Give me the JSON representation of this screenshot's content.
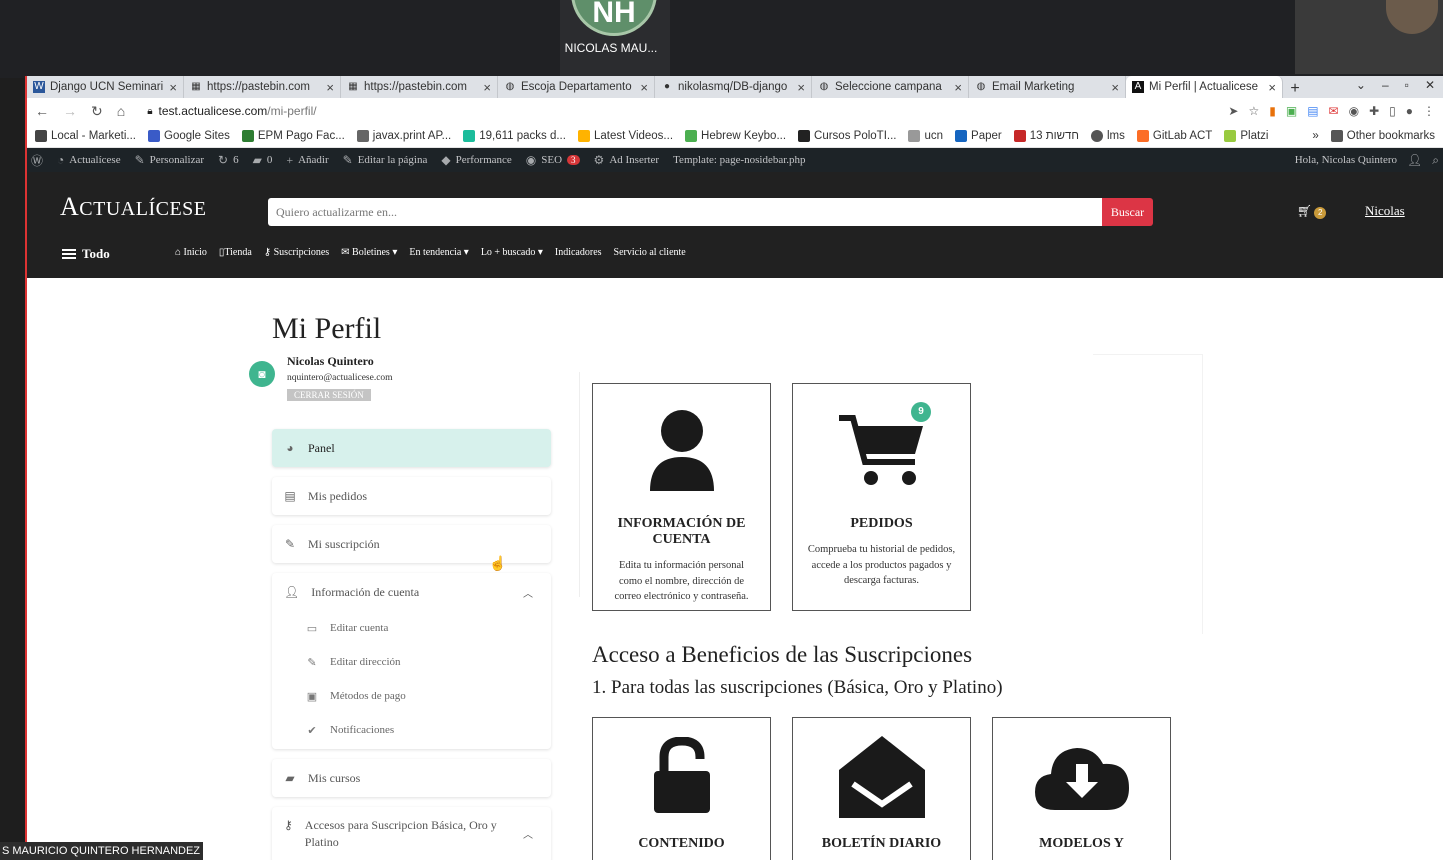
{
  "call": {
    "participant_initials": "NH",
    "participant_name": "NICOLAS MAU...",
    "presenter_label": "S MAURICIO QUINTERO HERNANDEZ"
  },
  "browser": {
    "tabs": [
      {
        "label": "Django UCN Seminari",
        "icon": "word-icon",
        "active": false
      },
      {
        "label": "https://pastebin.com",
        "icon": "pastebin-icon",
        "active": false
      },
      {
        "label": "https://pastebin.com",
        "icon": "pastebin-icon",
        "active": false
      },
      {
        "label": "Escoja Departamento",
        "icon": "globe-icon",
        "active": false
      },
      {
        "label": "nikolasmq/DB-django",
        "icon": "github-icon",
        "active": false
      },
      {
        "label": "Seleccione campana",
        "icon": "globe-icon",
        "active": false
      },
      {
        "label": "Email Marketing",
        "icon": "globe-icon",
        "active": false
      },
      {
        "label": "Mi Perfil | Actualicese",
        "icon": "actualicese-icon",
        "active": true
      }
    ],
    "url_host": "test.actualicese.com",
    "url_path": "/mi-perfil/",
    "bookmarks": [
      "Local - Marketi...",
      "Google Sites",
      "EPM Pago Fac...",
      "javax.print AP...",
      "19,611 packs d...",
      "Latest Videos...",
      "Hebrew Keybo...",
      "Cursos PoloTI...",
      "ucn",
      "Paper",
      "13 חדשות",
      "lms",
      "GitLab ACT",
      "Platzi"
    ],
    "other_bookmarks": "Other bookmarks",
    "more_bookmarks": "»"
  },
  "wpbar": {
    "site": "Actualícese",
    "customize": "Personalizar",
    "updates": "6",
    "comments": "0",
    "add": "Añadir",
    "edit": "Editar la página",
    "performance": "Performance",
    "seo": "SEO",
    "seo_count": "3",
    "ad_inserter": "Ad Inserter",
    "template": "Template: page-nosidebar.php",
    "greeting": "Hola, Nicolas Quintero"
  },
  "header": {
    "logo_first": "A",
    "logo_rest": "CTUALÍCESE",
    "search_placeholder": "Quiero actualizarme en...",
    "search_button": "Buscar",
    "cart_count": "2",
    "user": "Nicolas",
    "todo": "Todo",
    "nav": [
      "Inicio",
      "Tienda",
      "Suscripciones",
      "Boletines",
      "En tendencia",
      "Lo + buscado",
      "Indicadores",
      "Servicio al cliente"
    ]
  },
  "profile": {
    "title": "Mi Perfil",
    "name": "Nicolas Quintero",
    "email": "nquintero@actualicese.com",
    "logout": "CERRAR SESIÓN"
  },
  "sidebar": {
    "panel": "Panel",
    "orders": "Mis pedidos",
    "subscription": "Mi suscripción",
    "account_info": "Información de cuenta",
    "account_sub": [
      "Editar cuenta",
      "Editar dirección",
      "Métodos de pago",
      "Notificaciones"
    ],
    "courses": "Mis cursos",
    "access": "Accesos para Suscripcion Básica, Oro y Platino"
  },
  "cards": {
    "account": {
      "title": "INFORMACIÓN DE CUENTA",
      "desc": "Edita tu información personal como el nombre, dirección de correo electrónico y contraseña."
    },
    "orders": {
      "title": "PEDIDOS",
      "badge": "9",
      "desc": "Comprueba tu historial de pedidos, accede a los productos pagados y descarga facturas."
    },
    "benefits": [
      {
        "title": "CONTENIDO",
        "icon": "unlock-icon"
      },
      {
        "title": "BOLETÍN DIARIO",
        "icon": "envelope-open-icon"
      },
      {
        "title": "MODELOS Y",
        "icon": "cloud-download-icon"
      }
    ]
  },
  "benefits": {
    "heading": "Acceso a Beneficios de las Suscripciones",
    "subheading": "1. Para todas las suscripciones (Básica, Oro y Platino)"
  }
}
